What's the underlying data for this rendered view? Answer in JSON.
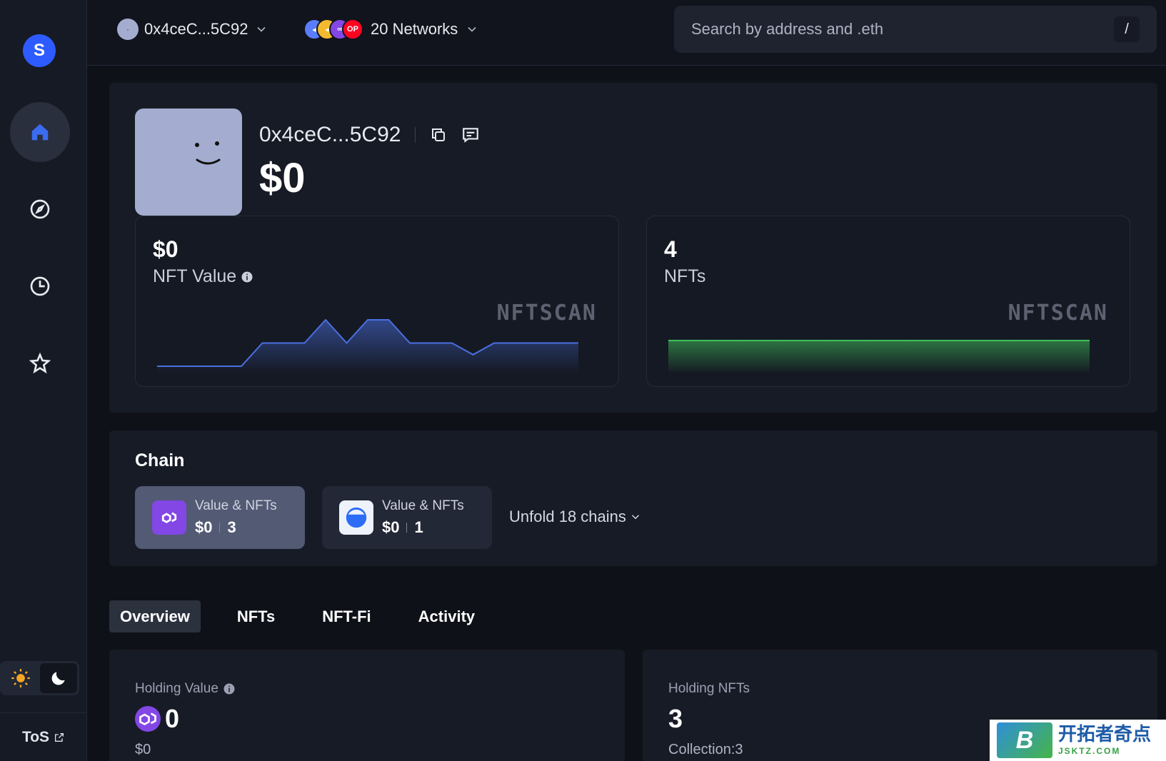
{
  "sidebar": {
    "logo_letter": "S",
    "tos_label": "ToS"
  },
  "topbar": {
    "account": "0x4ceC...5C92",
    "networks_label": "20 Networks",
    "network_badge": "OP",
    "search_placeholder": "Search by address and .eth",
    "search_shortcut": "/"
  },
  "profile": {
    "address": "0x4ceC...5C92",
    "total_value": "$0",
    "nft_value": {
      "value": "$0",
      "label": "NFT Value",
      "watermark": "NFTSCAN"
    },
    "nft_count": {
      "value": "4",
      "label": "NFTs",
      "watermark": "NFTSCAN"
    }
  },
  "chain": {
    "title": "Chain",
    "cards": [
      {
        "subtitle": "Value & NFTs",
        "value": "$0",
        "count": "3",
        "color": "#8247e5"
      },
      {
        "subtitle": "Value & NFTs",
        "value": "$0",
        "count": "1",
        "color": "#2d6cf6"
      }
    ],
    "unfold_label": "Unfold 18 chains"
  },
  "tabs": [
    "Overview",
    "NFTs",
    "NFT-Fi",
    "Activity"
  ],
  "holding_value": {
    "label": "Holding Value",
    "value": "0",
    "sub": "$0"
  },
  "holding_nfts": {
    "label": "Holding NFTs",
    "value": "3",
    "sub": "Collection:3"
  },
  "brand": {
    "cn": "开拓者奇点",
    "en": "JSKTZ.COM",
    "letter": "B"
  },
  "colors": {
    "accent": "#2d5bff",
    "polygon": "#8247e5",
    "chart_blue": "#4a6fe0",
    "chart_green": "#3fbf5b"
  },
  "chart_data": [
    {
      "type": "area",
      "series": [
        {
          "values": [
            0,
            0,
            0,
            0,
            0,
            1,
            1,
            1,
            2,
            1,
            2,
            2,
            1,
            1,
            1,
            0.5,
            1,
            1,
            1,
            1,
            1
          ]
        }
      ]
    },
    {
      "type": "area",
      "series": [
        {
          "values": [
            1,
            1,
            1,
            1,
            1,
            1,
            1,
            1,
            1,
            1,
            1
          ]
        }
      ]
    }
  ]
}
